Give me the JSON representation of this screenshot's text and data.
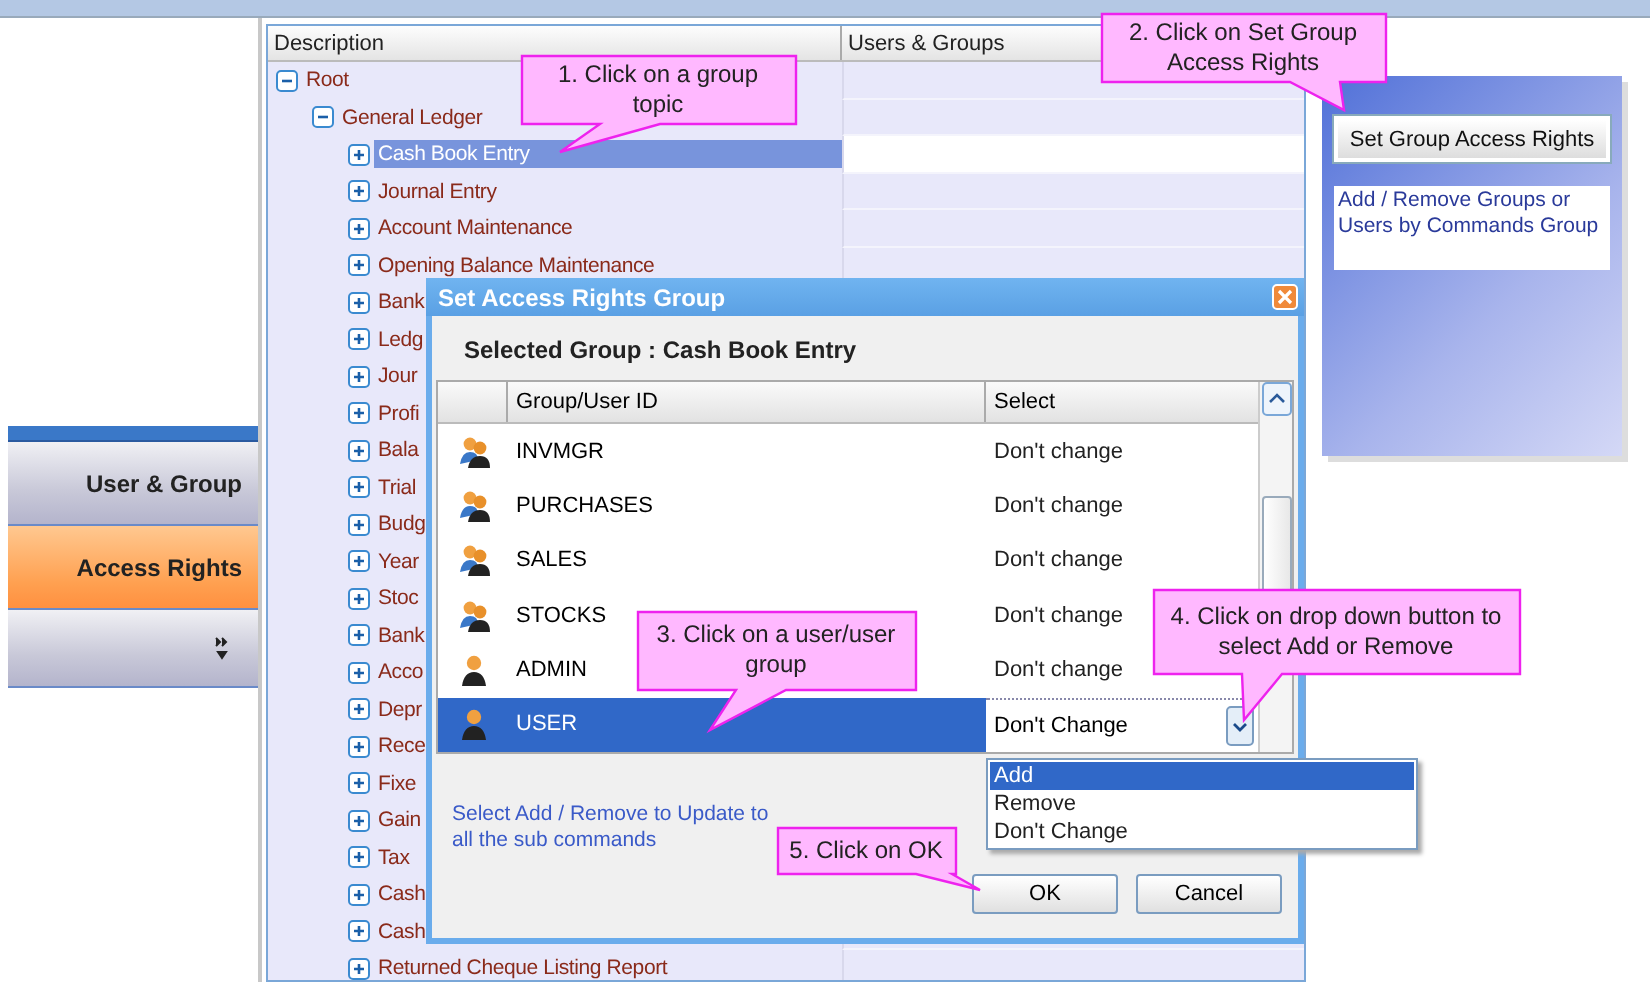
{
  "nav": [
    {
      "label": "User & Group",
      "selected": false
    },
    {
      "label": "Access Rights",
      "selected": true
    }
  ],
  "tree": {
    "columns": [
      "Description",
      "Users & Groups"
    ],
    "root": {
      "label": "Root",
      "expanded": true,
      "selected": false,
      "children": [
        {
          "label": "General Ledger",
          "expanded": true,
          "selected": false,
          "children": [
            {
              "label": "Cash Book Entry",
              "expanded": false,
              "selected": true
            },
            {
              "label": "Journal Entry",
              "expanded": false,
              "selected": false
            },
            {
              "label": "Account Maintenance",
              "expanded": false,
              "selected": false
            },
            {
              "label": "Opening Balance Maintenance",
              "expanded": false,
              "selected": false
            },
            {
              "label": "Bank",
              "expanded": false,
              "selected": false
            },
            {
              "label": "Ledg",
              "expanded": false,
              "selected": false
            },
            {
              "label": "Jour",
              "expanded": false,
              "selected": false
            },
            {
              "label": "Profi",
              "expanded": false,
              "selected": false
            },
            {
              "label": "Bala",
              "expanded": false,
              "selected": false
            },
            {
              "label": "Trial",
              "expanded": false,
              "selected": false
            },
            {
              "label": "Budg",
              "expanded": false,
              "selected": false
            },
            {
              "label": "Year",
              "expanded": false,
              "selected": false
            },
            {
              "label": "Stoc",
              "expanded": false,
              "selected": false
            },
            {
              "label": "Bank",
              "expanded": false,
              "selected": false
            },
            {
              "label": "Acco",
              "expanded": false,
              "selected": false
            },
            {
              "label": "Depr",
              "expanded": false,
              "selected": false
            },
            {
              "label": "Rece",
              "expanded": false,
              "selected": false
            },
            {
              "label": "Fixe",
              "expanded": false,
              "selected": false
            },
            {
              "label": "Gain",
              "expanded": false,
              "selected": false
            },
            {
              "label": "Tax",
              "expanded": false,
              "selected": false
            },
            {
              "label": "Cash",
              "expanded": false,
              "selected": false
            },
            {
              "label": "Cash",
              "expanded": false,
              "selected": false
            },
            {
              "label": "Returned Cheque Listing Report",
              "expanded": false,
              "selected": false
            }
          ]
        }
      ]
    }
  },
  "side_panel": {
    "button": "Set Group Access Rights",
    "description": "Add / Remove Groups or Users by Commands Group"
  },
  "dialog": {
    "title": "Set Access Rights Group",
    "heading": "Selected Group : Cash Book Entry",
    "columns": [
      "Group/User ID",
      "Select"
    ],
    "rows": [
      {
        "id": "INVMGR",
        "kind": "group",
        "select": "Don't change",
        "selected": false
      },
      {
        "id": "PURCHASES",
        "kind": "group",
        "select": "Don't change",
        "selected": false
      },
      {
        "id": "SALES",
        "kind": "group",
        "select": "Don't change",
        "selected": false
      },
      {
        "id": "STOCKS",
        "kind": "group",
        "select": "Don't change",
        "selected": false
      },
      {
        "id": "ADMIN",
        "kind": "user",
        "select": "Don't change",
        "selected": false
      },
      {
        "id": "USER",
        "kind": "user",
        "select": "Don't Change",
        "selected": true
      }
    ],
    "dropdown": [
      {
        "label": "Add",
        "selected": true
      },
      {
        "label": "Remove",
        "selected": false
      },
      {
        "label": "Don't Change",
        "selected": false
      }
    ],
    "hint": "Select Add / Remove to Update to all the sub commands",
    "buttons": [
      "OK",
      "Cancel"
    ]
  },
  "callouts": [
    "1. Click on a group topic",
    "2. Click on Set Group Access Rights",
    "3. Click on a user/user group",
    "4. Click on drop down button to select Add or Remove",
    "5. Click on OK"
  ]
}
